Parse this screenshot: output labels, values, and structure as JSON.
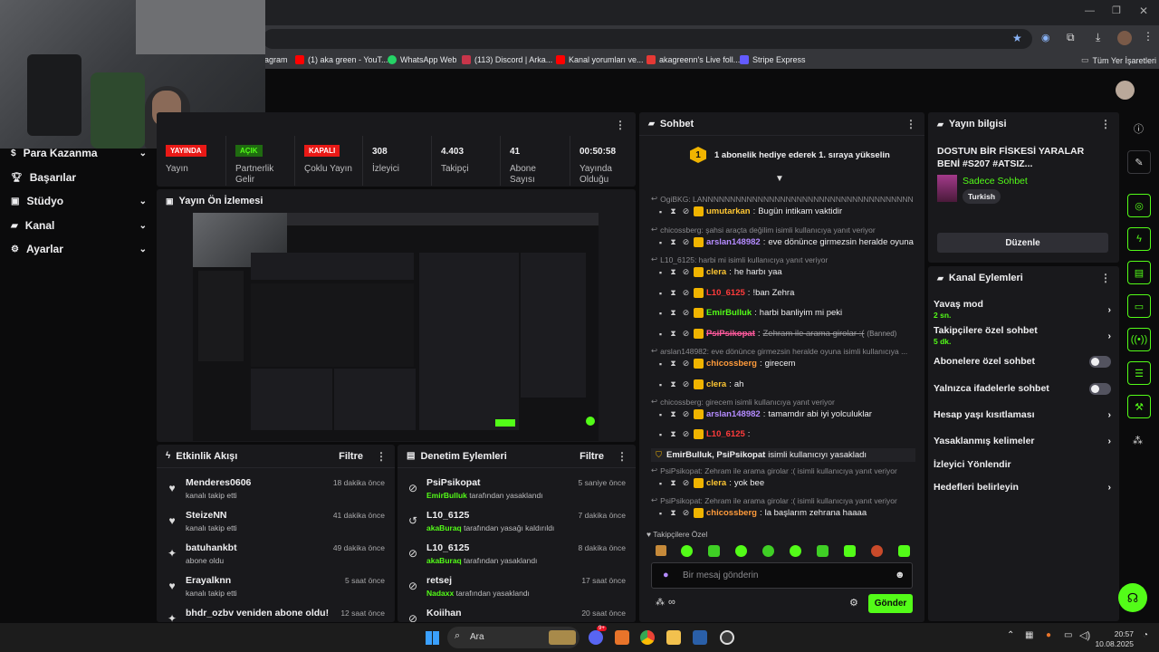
{
  "browser": {
    "bookmarks": [
      "agram",
      "(1) aka green - YouT...",
      "WhatsApp Web",
      "(113) Discord | Arka...",
      "Kanal yorumları ve...",
      "akagreenn's Live foll...",
      "Stripe Express"
    ],
    "all_bookmarks": "Tüm Yer İşaretleri"
  },
  "sidebar": {
    "items": [
      {
        "label": "Para Kazanma",
        "icon": "dollar-icon"
      },
      {
        "label": "Başarılar",
        "icon": "trophy-icon"
      },
      {
        "label": "Stüdyo",
        "icon": "studio-icon"
      },
      {
        "label": "Kanal",
        "icon": "channel-icon"
      },
      {
        "label": "Ayarlar",
        "icon": "gear-icon"
      }
    ]
  },
  "stats": [
    {
      "value": "YAYINDA",
      "label": "Yayın",
      "tag": true,
      "tag_color": "#e91916"
    },
    {
      "value": "AÇIK",
      "label": "Partnerlik Gelir",
      "tag": true,
      "tag_color": "#1f6b10"
    },
    {
      "value": "KAPALI",
      "label": "Çoklu Yayın",
      "tag": true,
      "tag_color": "#e91916"
    },
    {
      "value": "308",
      "label": "İzleyici"
    },
    {
      "value": "4.403",
      "label": "Takipçi"
    },
    {
      "value": "41",
      "label": "Abone Sayısı"
    },
    {
      "value": "00:50:58",
      "label": "Yayında Olduğu"
    }
  ],
  "preview": {
    "title": "Yayın Ön İzlemesi"
  },
  "activity": {
    "title": "Etkinlik Akışı",
    "filter": "Filtre",
    "items": [
      {
        "name": "Menderes0606",
        "sub": "kanalı takip etti",
        "time": "18 dakika önce",
        "icon": "heart-icon"
      },
      {
        "name": "SteizeNN",
        "sub": "kanalı takip etti",
        "time": "41 dakika önce",
        "icon": "heart-icon"
      },
      {
        "name": "batuhankbt",
        "sub": "abone oldu",
        "time": "49 dakika önce",
        "icon": "sparkle-icon"
      },
      {
        "name": "Erayalknn",
        "sub": "kanalı takip etti",
        "time": "5 saat önce",
        "icon": "heart-icon"
      },
      {
        "name": "bhdr_ozbv veniden abone oldu!",
        "sub": "",
        "time": "12 saat önce",
        "icon": "sparkle-icon"
      }
    ]
  },
  "moderation": {
    "title": "Denetim Eylemleri",
    "filter": "Filtre",
    "items": [
      {
        "name": "PsiPsikopat",
        "actor": "EmirBulluk",
        "sub": "tarafından yasaklandı",
        "time": "5 saniye önce",
        "icon": "ban-icon"
      },
      {
        "name": "L10_6125",
        "actor": "akaBuraq",
        "sub": "tarafından yasağı kaldırıldı",
        "time": "7 dakika önce",
        "icon": "undo-icon"
      },
      {
        "name": "L10_6125",
        "actor": "akaBuraq",
        "sub": "tarafından yasaklandı",
        "time": "8 dakika önce",
        "icon": "ban-icon"
      },
      {
        "name": "retsej",
        "actor": "Nadaxx",
        "sub": "tarafından yasaklandı",
        "time": "17 saat önce",
        "icon": "ban-icon"
      },
      {
        "name": "Koiihan",
        "actor": "",
        "sub": "",
        "time": "20 saat önce",
        "icon": "ban-icon"
      }
    ]
  },
  "chat": {
    "title": "Sohbet",
    "gift_banner": "1 abonelik hediye ederek 1. sıraya yükselin",
    "gift_number": "1",
    "lines": [
      {
        "reply": "OgiBKG: LANNNNNNNNNNNNNNNNNNNNNNNNNNNNNNNNNNNNNNNNNNNN..."
      },
      {
        "user": "umutarkan",
        "color": "#ffc733",
        "text": "Bugün intikam vaktidir"
      },
      {
        "reply": "chicossberg: şahsi araçta değilim isimli kullanıcıya yanıt veriyor"
      },
      {
        "user": "arslan148982",
        "color": "#b48bff",
        "text": "eve dönünce girmezsin heralde oyuna"
      },
      {
        "reply": "L10_6125: harbi mi isimli kullanıcıya yanıt veriyor"
      },
      {
        "user": "clera",
        "color": "#ffc733",
        "text": "he harbı yaa"
      },
      {
        "user": "L10_6125",
        "color": "#ff3b3b",
        "text": "!ban Zehra"
      },
      {
        "user": "EmirBulluk",
        "color": "#53fc18",
        "text": "harbi banliyim mi peki"
      },
      {
        "user": "PsiPsikopat",
        "color": "#ff5a9d",
        "text": "Zehram ile arama girolar :(",
        "banned": "(Banned)"
      },
      {
        "reply": "arslan148982: eve dönünce girmezsin heralde oyuna isimli kullanıcıya ..."
      },
      {
        "user": "chicossberg",
        "color": "#ff9b3b",
        "text": "girecem"
      },
      {
        "user": "clera",
        "color": "#ffc733",
        "text": "ah"
      },
      {
        "reply": "chicossberg: girecem isimli kullanıcıya yanıt veriyor"
      },
      {
        "user": "arslan148982",
        "color": "#b48bff",
        "text": "tamamdır abi iyi yolculuklar"
      },
      {
        "user": "L10_6125",
        "color": "#ff3b3b",
        "text": ""
      },
      {
        "system": "EmirBulluk, PsiPsikopat",
        "system_text": "isimli kullanıcıyı yasakladı"
      },
      {
        "reply": "PsiPsikopat: Zehram ile arama girolar :( isimli kullanıcıya yanıt veriyor"
      },
      {
        "user": "clera",
        "color": "#ffc733",
        "text": "yok bee"
      },
      {
        "reply": "PsiPsikopat: Zehram ile arama girolar :( isimli kullanıcıya yanıt veriyor"
      },
      {
        "user": "chicossberg",
        "color": "#ff9b3b",
        "text": "la başlarım zehrana haaaa"
      }
    ],
    "follower_only": "Takipçilere Özel",
    "input_placeholder": "Bir mesaj gönderin",
    "send": "Gönder"
  },
  "stream_info": {
    "title": "Yayın bilgisi",
    "stream_title": "DOSTUN BİR FİSKESİ YARALAR BENİ #S207 #ATSIZ...",
    "category": "Sadece Sohbet",
    "language": "Turkish",
    "edit": "Düzenle"
  },
  "channel_actions": {
    "title": "Kanal Eylemleri",
    "items": [
      {
        "label": "Yavaş mod",
        "value": "2 sn.",
        "kind": "chevron"
      },
      {
        "label": "Takipçilere özel sohbet",
        "value": "5 dk.",
        "kind": "chevron"
      },
      {
        "label": "Abonelere özel sohbet",
        "kind": "toggle"
      },
      {
        "label": "Yalnızca ifadelerle sohbet",
        "kind": "toggle"
      },
      {
        "label": "Hesap yaşı kısıtlaması",
        "kind": "chevron"
      },
      {
        "label": "Yasaklanmış kelimeler",
        "kind": "chevron"
      },
      {
        "label": "İzleyici Yönlendir",
        "kind": "none"
      },
      {
        "label": "Hedefleri belirleyin",
        "kind": "chevron"
      }
    ]
  },
  "taskbar": {
    "search": "Ara",
    "time": "20:57",
    "date": "10.08.2025",
    "discord_badge": "9+"
  }
}
